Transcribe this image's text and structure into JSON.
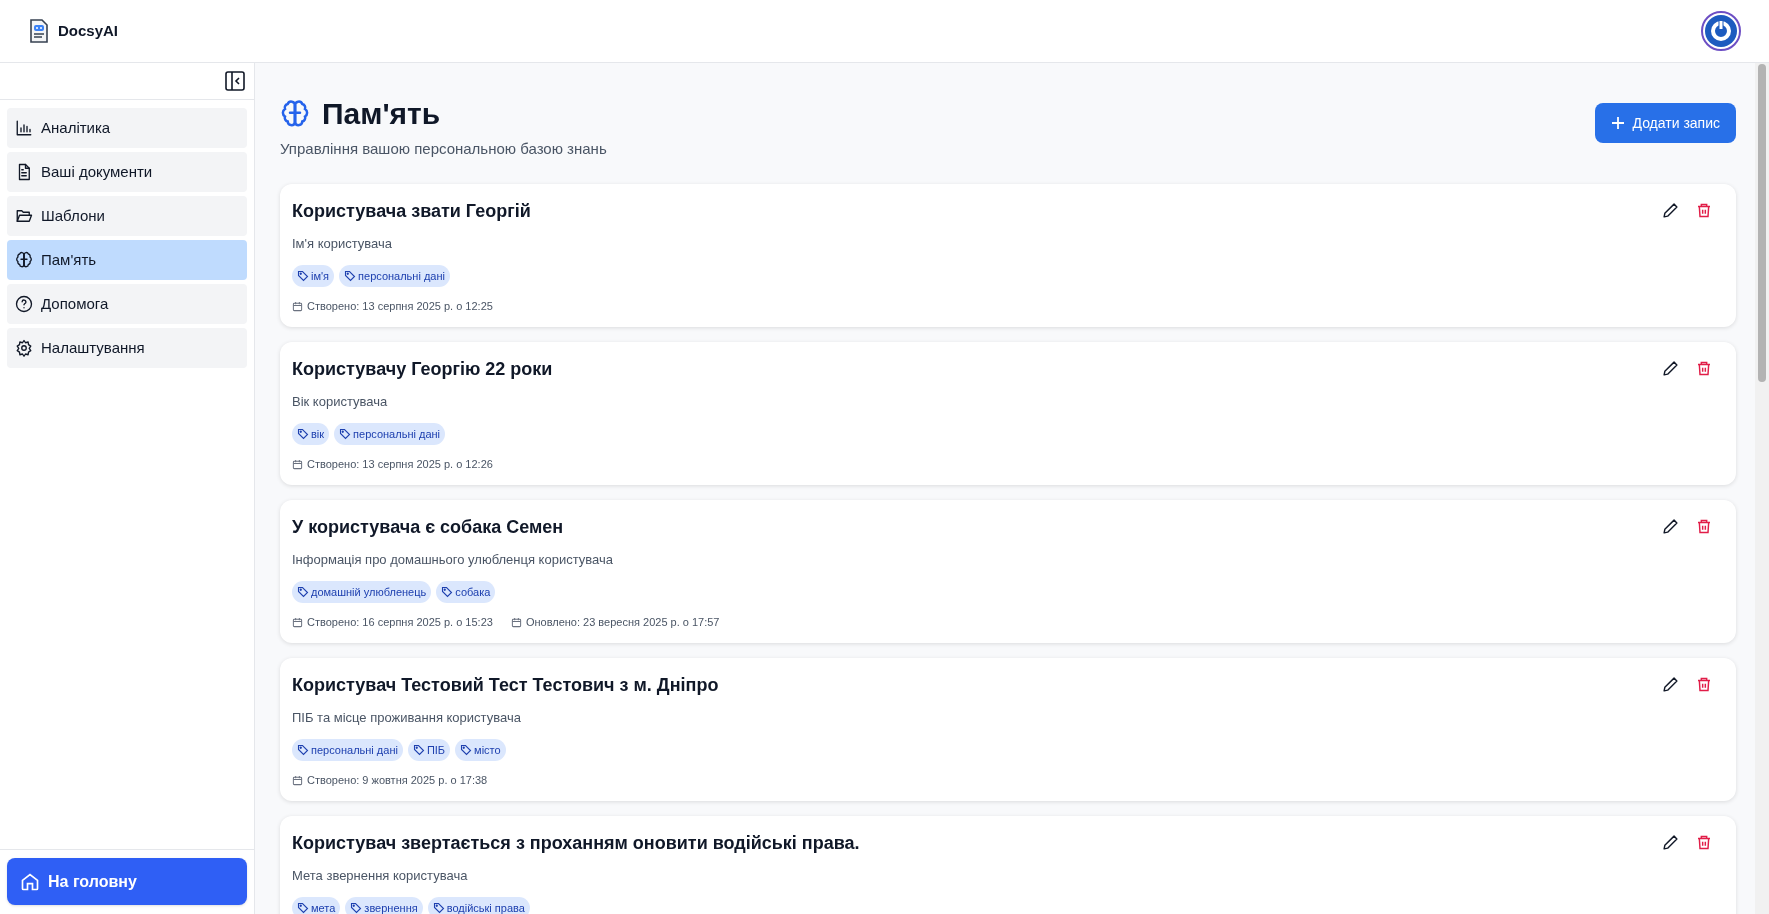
{
  "header": {
    "brand": "DocsyAI"
  },
  "sidebar": {
    "items": [
      {
        "label": "Аналітика",
        "selected": false
      },
      {
        "label": "Ваші документи",
        "selected": false
      },
      {
        "label": "Шаблони",
        "selected": false
      },
      {
        "label": "Пам'ять",
        "selected": true
      },
      {
        "label": "Допомога",
        "selected": false
      },
      {
        "label": "Налаштування",
        "selected": false
      }
    ],
    "home_button": "На головну"
  },
  "page": {
    "title": "Пам'ять",
    "subtitle": "Управління вашою персональною базою знань",
    "add_button": "Додати запис"
  },
  "entries": [
    {
      "title": "Користувача звати Георгій",
      "description": "Ім'я користувача",
      "tags": [
        "ім'я",
        "персональні дані"
      ],
      "dates": [
        "Створено: 13 серпня 2025 р. о 12:25"
      ]
    },
    {
      "title": "Користувачу Георгію 22 роки",
      "description": "Вік користувача",
      "tags": [
        "вік",
        "персональні дані"
      ],
      "dates": [
        "Створено: 13 серпня 2025 р. о 12:26"
      ]
    },
    {
      "title": "У користувача є собака Семен",
      "description": "Інформація про домашнього улюбленця користувача",
      "tags": [
        "домашній улюбленець",
        "собака"
      ],
      "dates": [
        "Створено: 16 серпня 2025 р. о 15:23",
        "Оновлено: 23 вересня 2025 р. о 17:57"
      ]
    },
    {
      "title": "Користувач Тестовий Тест Тестович з м. Дніпро",
      "description": "ПІБ та місце проживання користувача",
      "tags": [
        "персональні дані",
        "ПІБ",
        "місто"
      ],
      "dates": [
        "Створено: 9 жовтня 2025 р. о 17:38"
      ]
    },
    {
      "title": "Користувач звертається з проханням оновити водійські права.",
      "description": "Мета звернення користувача",
      "tags": [
        "мета",
        "звернення",
        "водійські права"
      ]
    }
  ]
}
